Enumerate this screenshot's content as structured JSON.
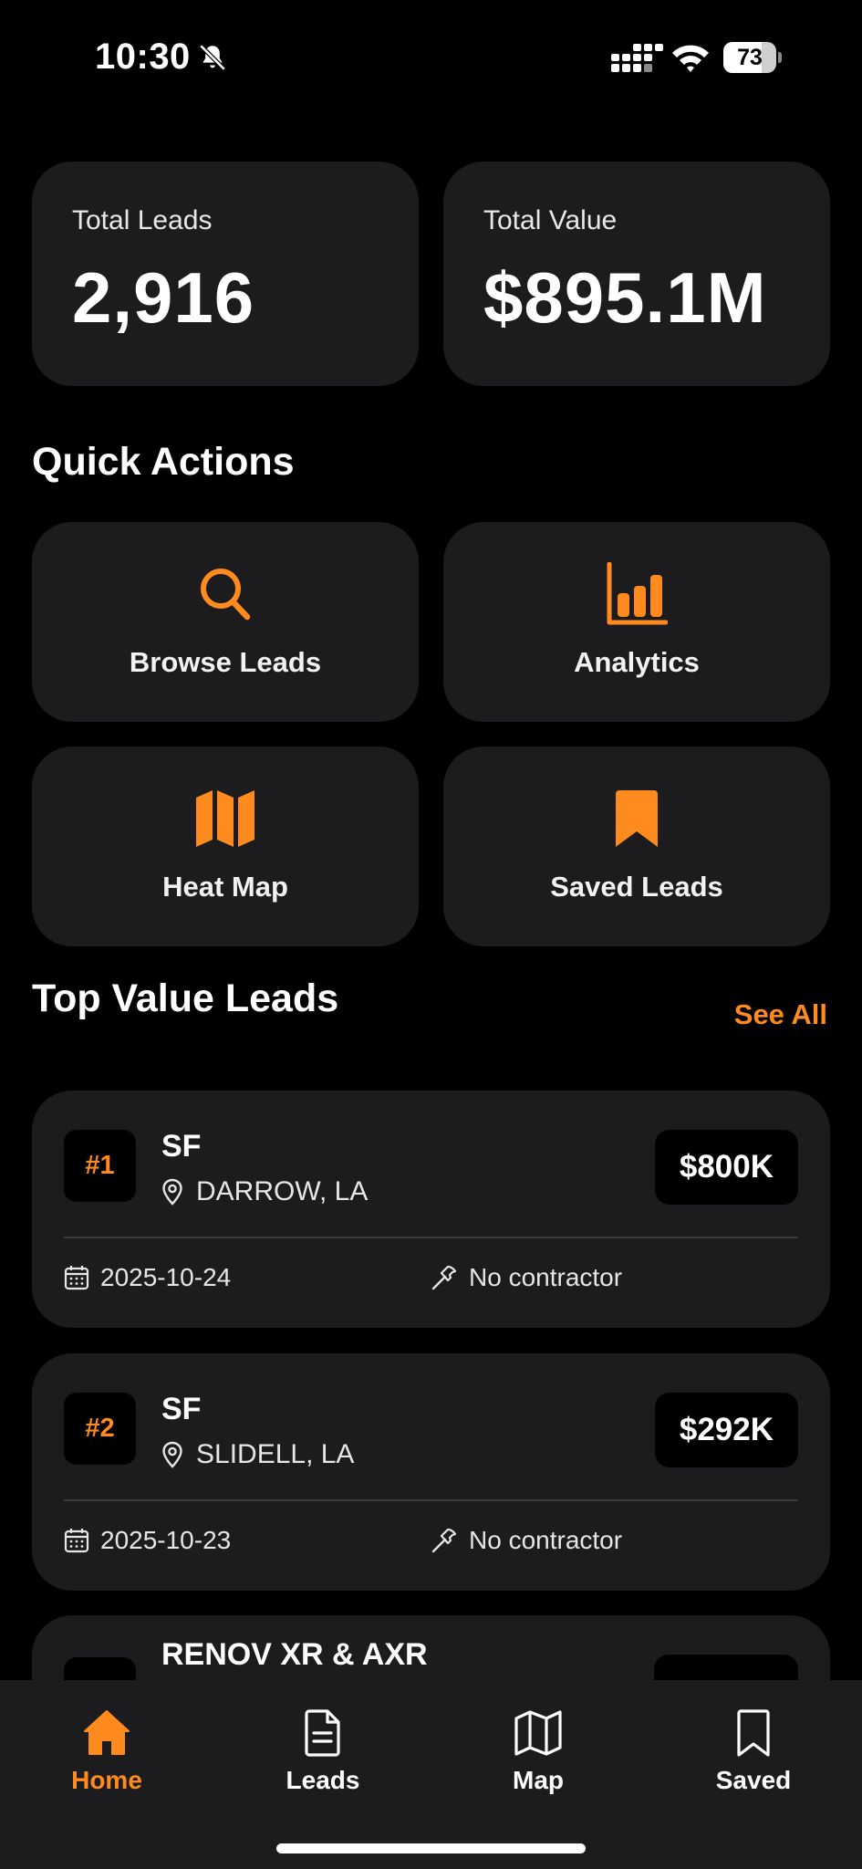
{
  "status_bar": {
    "time": "10:30",
    "battery": "73",
    "battery_level": 0.73
  },
  "stats": {
    "total_leads_label": "Total Leads",
    "total_leads_value": "2,916",
    "total_value_label": "Total Value",
    "total_value_value": "$895.1M"
  },
  "quick_actions": {
    "title": "Quick Actions",
    "items": [
      {
        "label": "Browse Leads",
        "icon": "search-icon"
      },
      {
        "label": "Analytics",
        "icon": "bar-chart-icon"
      },
      {
        "label": "Heat Map",
        "icon": "map-icon"
      },
      {
        "label": "Saved Leads",
        "icon": "bookmark-icon"
      }
    ]
  },
  "top_leads": {
    "title": "Top Value Leads",
    "see_all": "See All",
    "items": [
      {
        "rank": "#1",
        "type": "SF",
        "location": "DARROW, LA",
        "value": "$800K",
        "date": "2025-10-24",
        "contractor": "No contractor"
      },
      {
        "rank": "#2",
        "type": "SF",
        "location": "SLIDELL, LA",
        "value": "$292K",
        "date": "2025-10-23",
        "contractor": "No contractor"
      },
      {
        "type": "RENOV XR & AXR"
      }
    ]
  },
  "tabbar": {
    "items": [
      {
        "label": "Home",
        "icon": "home-icon",
        "active": true
      },
      {
        "label": "Leads",
        "icon": "document-icon"
      },
      {
        "label": "Map",
        "icon": "map-icon"
      },
      {
        "label": "Saved",
        "icon": "bookmark-icon"
      }
    ]
  },
  "colors": {
    "accent": "#ff8a1e",
    "card": "#1c1c1e",
    "background": "#000000"
  }
}
